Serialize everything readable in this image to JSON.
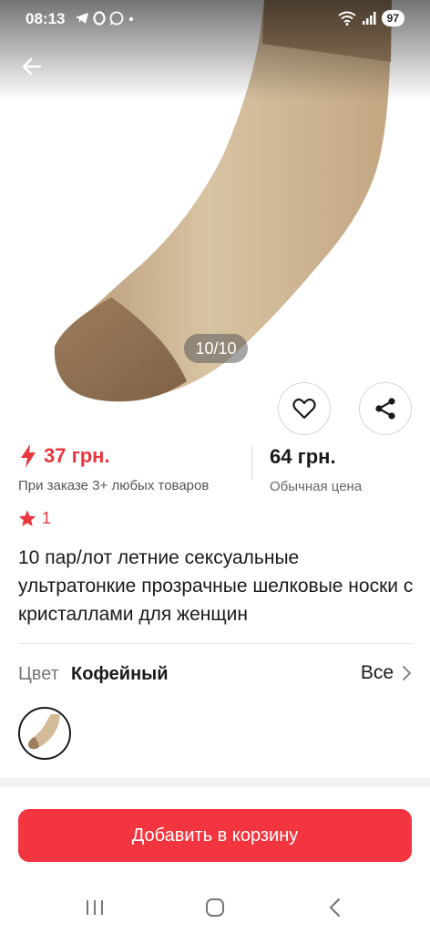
{
  "status_bar": {
    "time": "08:13",
    "battery": "97"
  },
  "gallery": {
    "counter": "10/10"
  },
  "price": {
    "sale_price": "37 грн.",
    "sale_note": "При заказе 3+ любых товаров",
    "regular_price": "64 грн.",
    "regular_note": "Обычная цена"
  },
  "rating": {
    "value": "1"
  },
  "product": {
    "title": "10 пар/лот летние сексуальные ультратонкие прозрачные шелковые носки с кристаллами для женщин"
  },
  "color": {
    "label": "Цвет",
    "value": "Кофейный",
    "all_label": "Все"
  },
  "actions": {
    "add_to_cart": "Добавить в корзину"
  },
  "colors": {
    "accent": "#f2353f",
    "sale_text": "#e8373e"
  }
}
